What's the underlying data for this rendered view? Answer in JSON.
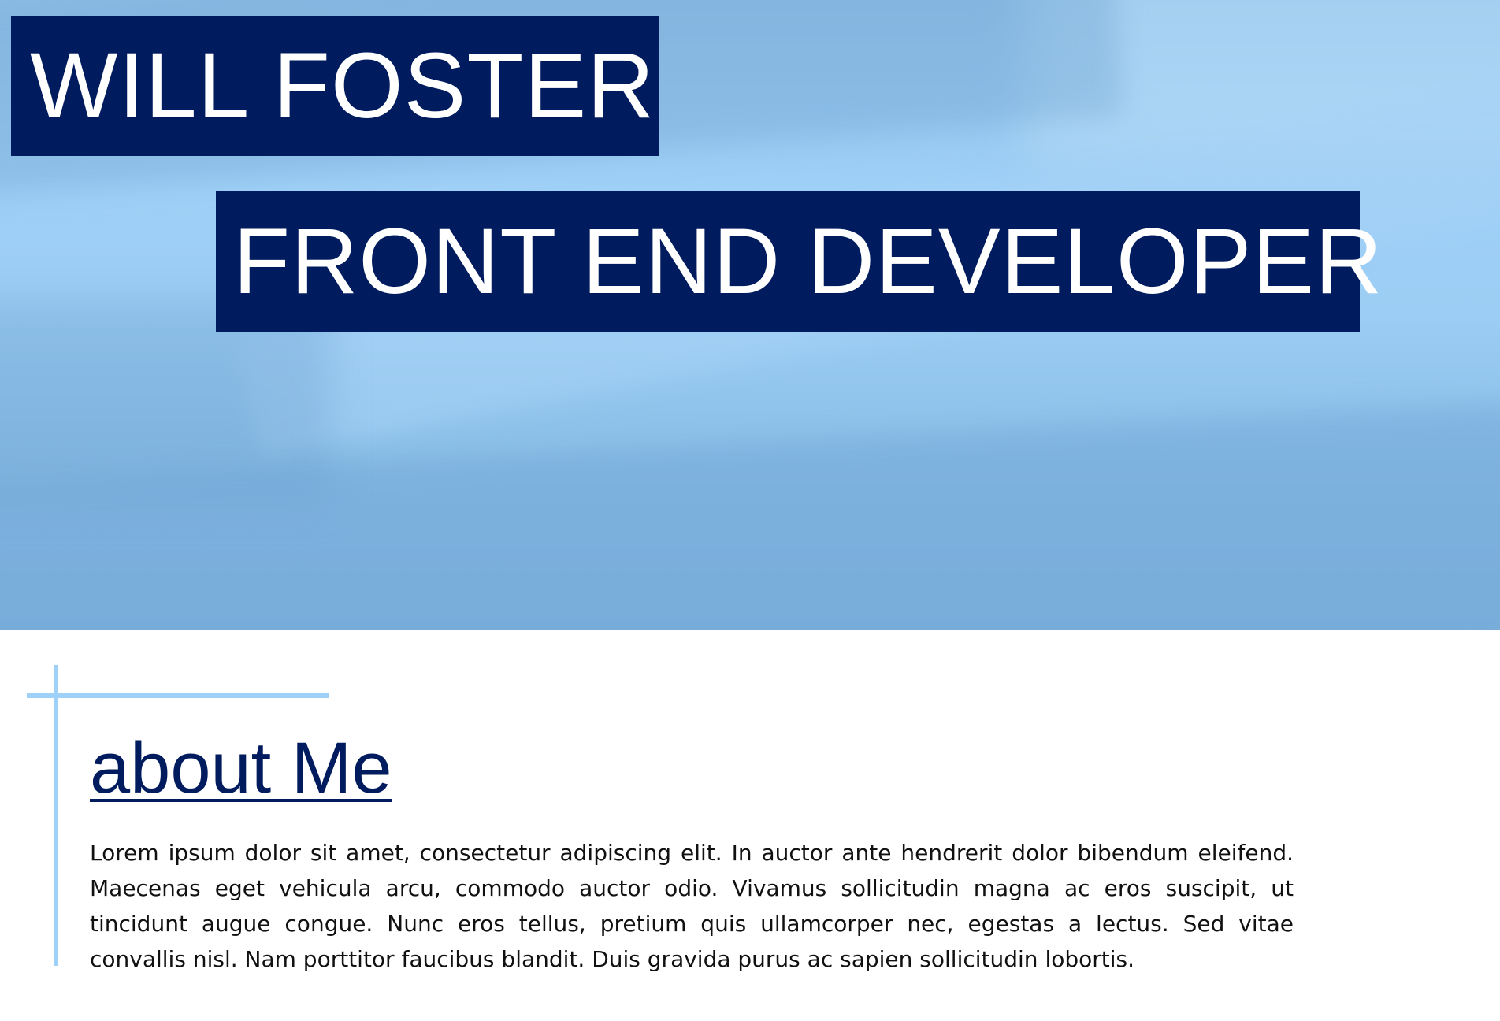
{
  "colors": {
    "navy": "#001b5e",
    "light_blue": "#9fd0f7",
    "text": "#111111",
    "background": "#ffffff"
  },
  "hero": {
    "name": "WILL FOSTER",
    "role": "FRONT END DEVELOPER"
  },
  "about": {
    "heading": "about Me",
    "body": "Lorem ipsum dolor sit amet, consectetur adipiscing elit. In auctor ante hendrerit dolor bibendum eleifend. Maecenas eget vehicula arcu, commodo auctor odio. Vivamus sollicitudin magna ac eros suscipit, ut tincidunt augue congue. Nunc eros tellus, pretium quis ullamcorper nec, egestas a lectus. Sed vitae convallis nisl. Nam porttitor faucibus blandit. Duis gravida purus ac sapien sollicitudin lobortis."
  }
}
